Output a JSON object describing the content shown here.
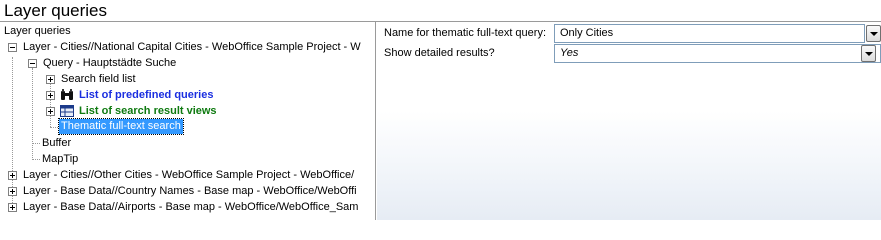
{
  "window": {
    "title": "Layer queries"
  },
  "tree": {
    "root_label": "Layer queries",
    "nodes": [
      {
        "label": "Layer - Cities//National Capital Cities - WebOffice Sample Project - W"
      },
      {
        "label": "Query - Hauptstädte Suche"
      },
      {
        "label": "Search field list"
      },
      {
        "label": "List of predefined queries"
      },
      {
        "label": "List of search result views"
      },
      {
        "label": "Thematic full-text search"
      },
      {
        "label": "Buffer"
      },
      {
        "label": "MapTip"
      },
      {
        "label": "Layer - Cities//Other Cities - WebOffice Sample Project - WebOffice/"
      },
      {
        "label": "Layer - Base Data//Country Names - Base map - WebOffice/WebOffi"
      },
      {
        "label": "Layer - Base Data//Airports - Base map - WebOffice/WebOffice_Sam"
      }
    ],
    "selected": "Thematic full-text search"
  },
  "properties": {
    "fulltext_name_label": "Name for thematic full-text query:",
    "fulltext_name_value": "Only Cities",
    "show_detailed_label": "Show detailed results?",
    "show_detailed_value": "Yes"
  },
  "colors": {
    "selection": "#3399ff",
    "predefined_queries_text": "#1a2ee0",
    "result_views_text": "#0e7a10"
  },
  "icons": [
    "binoculars-icon",
    "table-icon",
    "expand-plus-icon",
    "collapse-minus-icon",
    "dropdown-arrow-icon"
  ]
}
